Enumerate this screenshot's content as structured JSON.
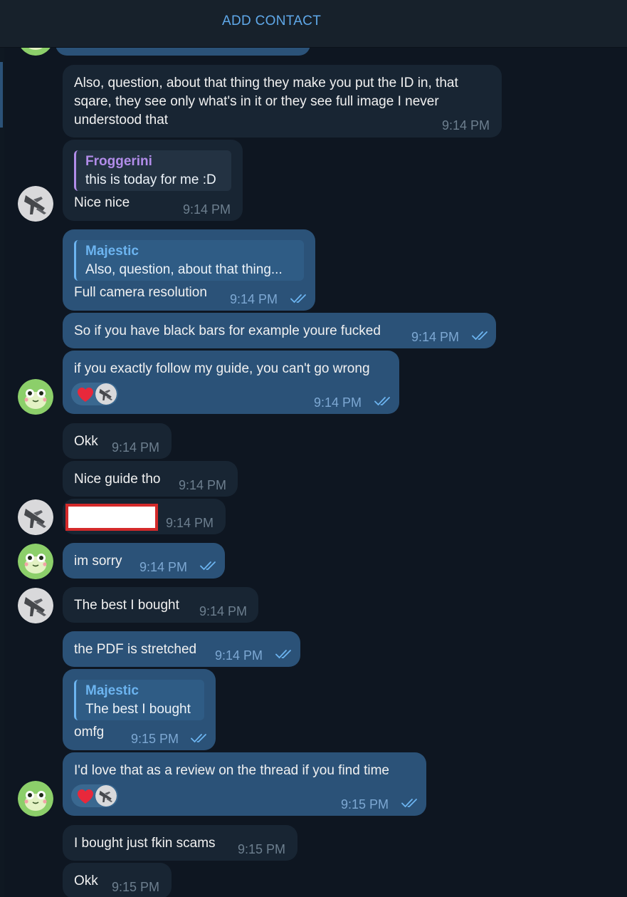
{
  "header": {
    "title": "ADD CONTACT"
  },
  "messages": [
    {
      "text": "Also, question, about that thing they make you put the ID in, that sqare, they see only what's in it or they see full image I never understood that",
      "time": "9:14 PM"
    },
    {
      "reply_author": "Froggerini",
      "reply_text": "this is today for me :D",
      "text": "Nice nice",
      "time": "9:14 PM"
    },
    {
      "reply_author": "Majestic",
      "reply_text": "Also, question, about that thing...",
      "text": "Full camera resolution",
      "time": "9:14 PM"
    },
    {
      "text": "So if you have black bars for example youre fucked",
      "time": "9:14 PM"
    },
    {
      "text": "if you exactly follow my guide, you can't go wrong",
      "time": "9:14 PM"
    },
    {
      "text": "Okk",
      "time": "9:14 PM"
    },
    {
      "text": "Nice guide tho",
      "time": "9:14 PM"
    },
    {
      "text": "",
      "time": "9:14 PM"
    },
    {
      "text": "im sorry",
      "time": "9:14 PM"
    },
    {
      "text": "The best I bought",
      "time": "9:14 PM"
    },
    {
      "text": "the PDF is stretched",
      "time": "9:14 PM"
    },
    {
      "reply_author": "Majestic",
      "reply_text": "The best I bought",
      "text": "omfg",
      "time": "9:15 PM"
    },
    {
      "text": "I'd love that as a review on the thread if you find time",
      "time": "9:15 PM"
    },
    {
      "text": "I bought just fkin scams",
      "time": "9:15 PM"
    },
    {
      "text": "Okk",
      "time": "9:15 PM"
    }
  ],
  "reactions": {
    "emoji": "heart-icon"
  },
  "colors": {
    "outgoing": "#2b5278",
    "incoming": "#182533",
    "background": "#0e1621",
    "accent": "#5fa8e9"
  }
}
